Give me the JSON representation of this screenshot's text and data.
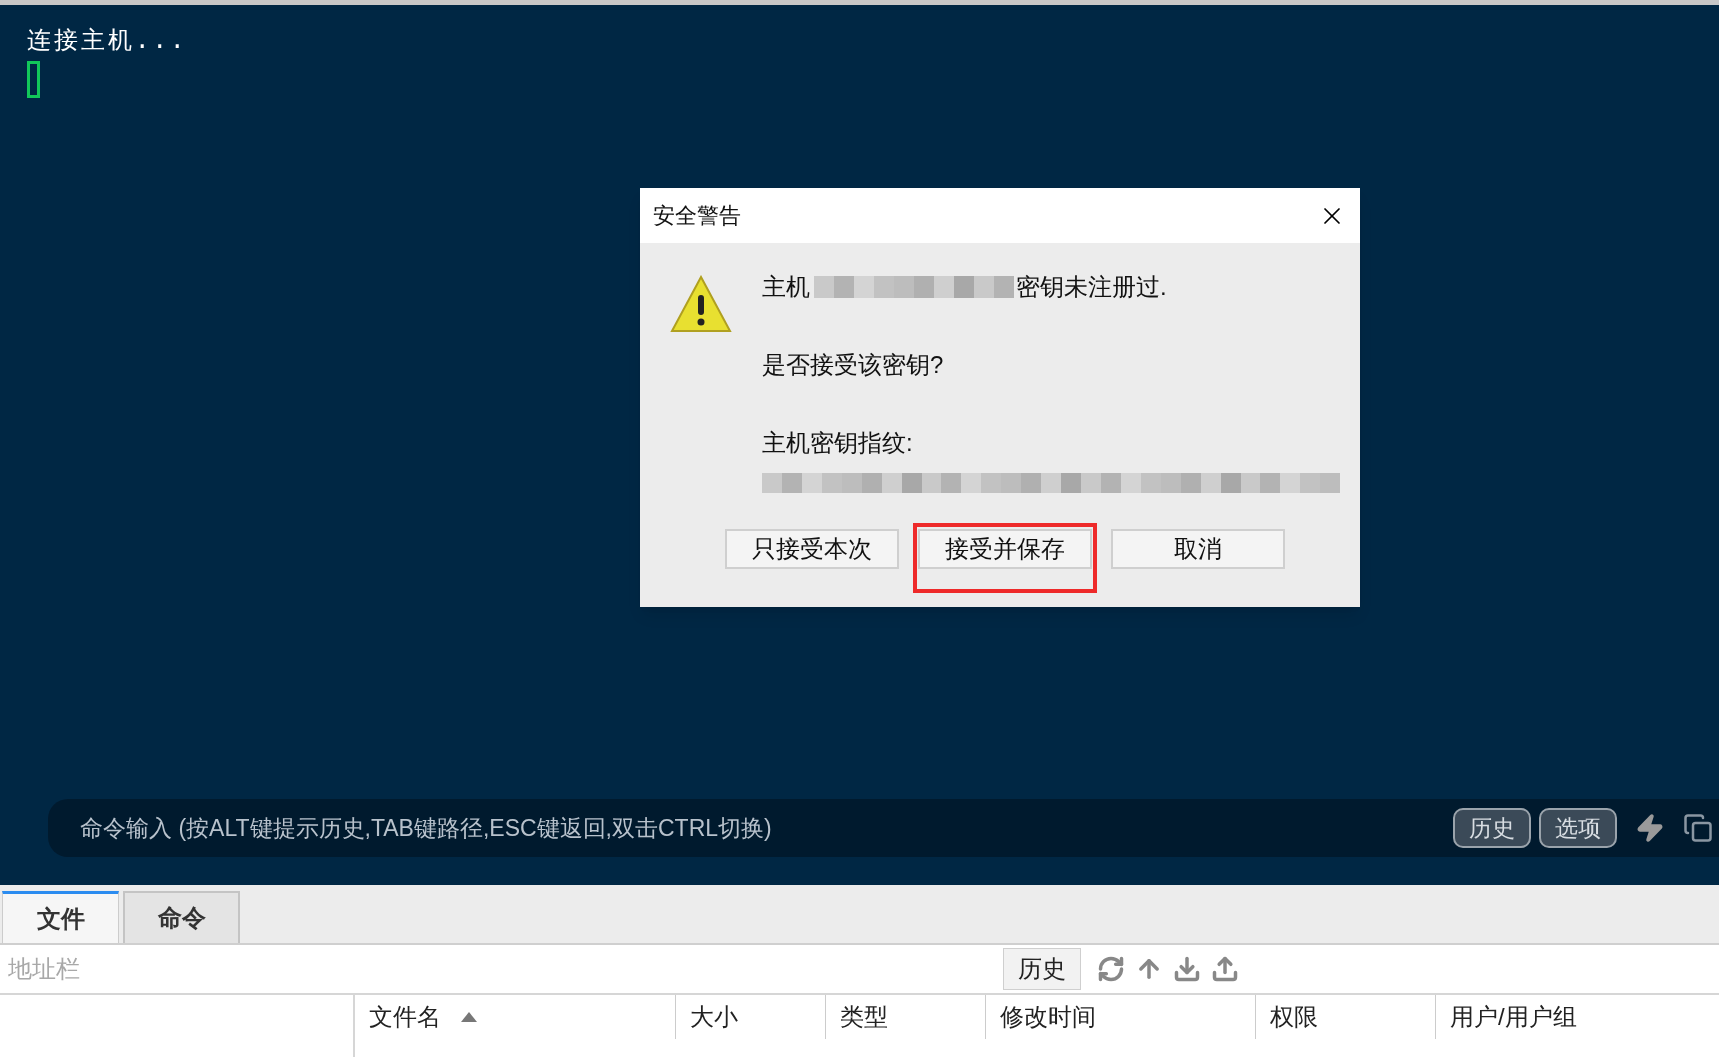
{
  "terminal": {
    "lines": [
      "连接主机..."
    ]
  },
  "dialog": {
    "title": "安全警告",
    "host_prefix": "主机",
    "host_suffix": "密钥未注册过.",
    "question": "是否接受该密钥?",
    "fingerprint_label": "主机密钥指纹:",
    "buttons": [
      {
        "label": "只接受本次",
        "highlighted": false
      },
      {
        "label": "接受并保存",
        "highlighted": true
      },
      {
        "label": "取消",
        "highlighted": false
      }
    ]
  },
  "command_bar": {
    "placeholder": "命令输入 (按ALT键提示历史,TAB键路径,ESC键返回,双击CTRL切换)",
    "buttons": [
      "历史",
      "选项"
    ]
  },
  "tabs": [
    {
      "label": "文件",
      "selected": true
    },
    {
      "label": "命令",
      "selected": false
    }
  ],
  "address_bar": {
    "placeholder": "地址栏",
    "history_button": "历史"
  },
  "columns": [
    {
      "label": "文件名",
      "sorted": true
    },
    {
      "label": "大小",
      "sorted": false
    },
    {
      "label": "类型",
      "sorted": false
    },
    {
      "label": "修改时间",
      "sorted": false
    },
    {
      "label": "权限",
      "sorted": false
    },
    {
      "label": "用户/用户组",
      "sorted": false
    }
  ]
}
